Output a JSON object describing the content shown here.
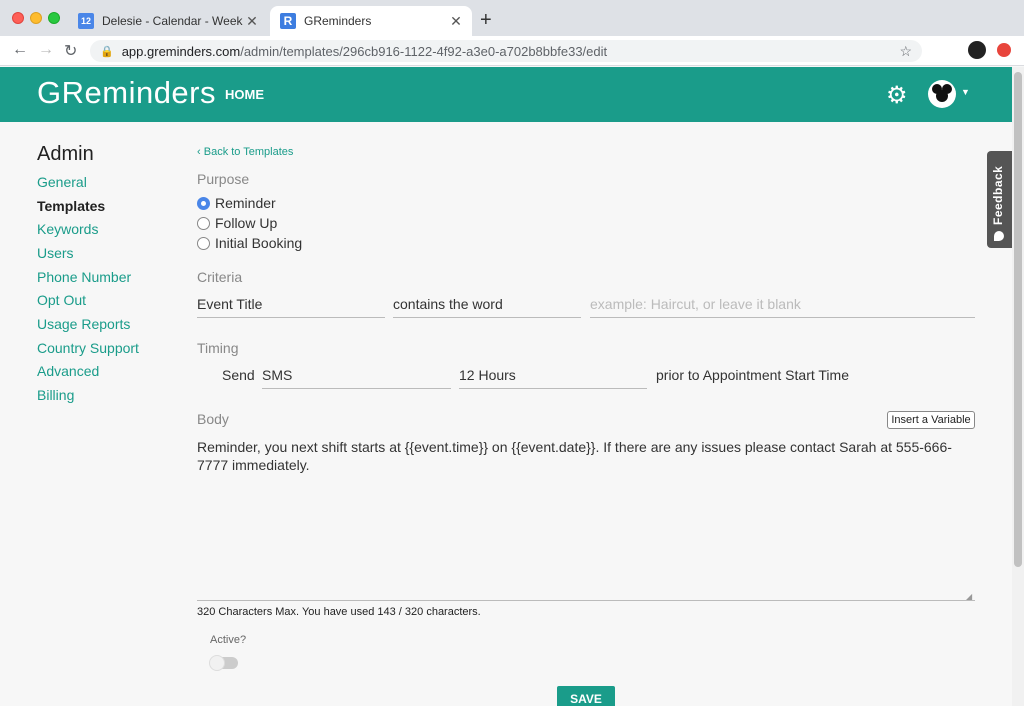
{
  "browser": {
    "tabs": [
      {
        "favicon": "12",
        "title": "Delesie - Calendar - Week of Ma",
        "close": "✕"
      },
      {
        "favicon": "R",
        "title": "GReminders",
        "close": "✕"
      }
    ],
    "new_tab": "+",
    "url_host": "app.greminders.com",
    "url_path": "/admin/templates/296cb916-1122-4f92-a3e0-a702b8bbfe33/edit",
    "icons": {
      "back": "arrow-left-icon",
      "forward": "arrow-right-icon",
      "reload": "reload-icon",
      "lock": "lock-icon",
      "bookmark": "star-icon"
    }
  },
  "header": {
    "logo": "GReminders",
    "home": "HOME",
    "accent_color": "#1a9c8a"
  },
  "sidebar": {
    "title": "Admin",
    "items": [
      {
        "label": "General"
      },
      {
        "label": "Templates"
      },
      {
        "label": "Keywords"
      },
      {
        "label": "Users"
      },
      {
        "label": "Phone Number"
      },
      {
        "label": "Opt Out"
      },
      {
        "label": "Usage Reports"
      },
      {
        "label": "Country Support"
      },
      {
        "label": "Advanced"
      },
      {
        "label": "Billing"
      }
    ],
    "active_index": 1
  },
  "main": {
    "back_link": "Back to Templates",
    "purpose": {
      "label": "Purpose",
      "options": [
        "Reminder",
        "Follow Up",
        "Initial Booking"
      ],
      "selected": "Reminder"
    },
    "criteria": {
      "label": "Criteria",
      "field": "Event Title",
      "operator": "contains the word",
      "value_placeholder": "example: Haircut, or leave it blank"
    },
    "timing": {
      "label": "Timing",
      "send_label": "Send",
      "channel": "SMS",
      "offset": "12 Hours",
      "suffix": "prior to Appointment Start Time"
    },
    "body": {
      "label": "Body",
      "insert_variable": "Insert a Variable",
      "text": "Reminder, you next shift starts at {{event.time}} on {{event.date}}.  If there are any issues please contact Sarah at 555-666-7777 immediately.",
      "counter": "320 Characters Max. You have used 143 / 320 characters."
    },
    "active": {
      "label": "Active?",
      "on": false
    },
    "save": "SAVE"
  },
  "feedback": "Feedback"
}
